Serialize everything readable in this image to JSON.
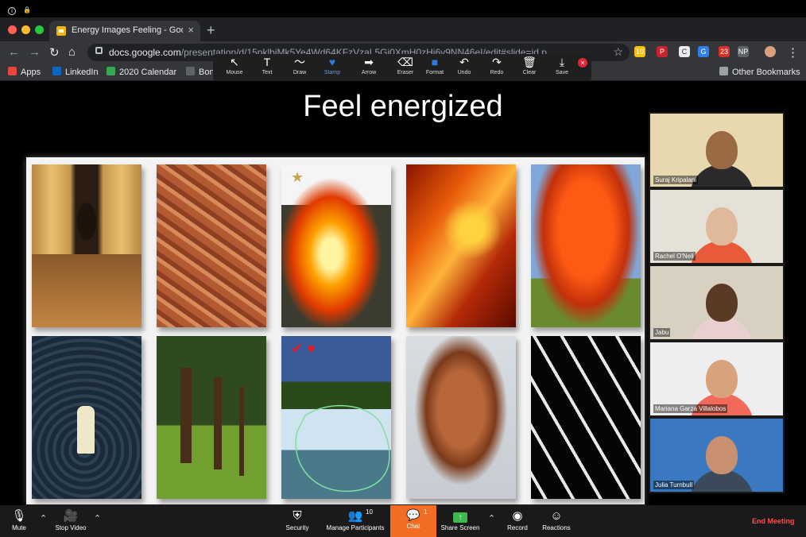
{
  "system": {
    "info_icon": "info-icon",
    "lock_icon": "lock-icon"
  },
  "browser": {
    "tab_title": "Energy Images Feeling - Google Slides",
    "new_tab": "+",
    "url_host": "docs.google.com",
    "url_path": "/presentation/d/15pklbiMk5Ye4Wd64KFzVzaL5Gi0XmH0zHi6v9NN46eI/edit#slide=id.p",
    "extensions": [
      {
        "name": "sticky-notes-ext",
        "label": "10",
        "color": "#f4c20d"
      },
      {
        "name": "pinterest-ext",
        "label": "P",
        "color": "#c8232c"
      },
      {
        "name": "copy-ext",
        "label": "C",
        "color": "#e8eaed"
      },
      {
        "name": "grammarly-ext",
        "label": "G",
        "color": "#2f80ed"
      },
      {
        "name": "photos-ext",
        "label": "23",
        "color": "#d93025"
      },
      {
        "name": "np-ext",
        "label": "NP",
        "color": "#5f6368"
      }
    ],
    "bookmarks": [
      {
        "label": "Apps",
        "icon": "apps-grid-icon",
        "color": "#e8453c"
      },
      {
        "label": "LinkedIn",
        "icon": "linkedin-icon",
        "color": "#0a66c2"
      },
      {
        "label": "2020 Calendar",
        "icon": "calendar-icon",
        "color": "#34a853"
      },
      {
        "label": "Bon",
        "icon": "bookmark-icon",
        "color": "#5f6368"
      }
    ],
    "other_bookmarks": "Other Bookmarks"
  },
  "annotation_toolbar": {
    "tools": [
      {
        "label": "Mouse",
        "icon": "mouse-pointer-icon",
        "glyph": "↖"
      },
      {
        "label": "Text",
        "icon": "text-icon",
        "glyph": "T"
      },
      {
        "label": "Draw",
        "icon": "draw-icon",
        "glyph": "〜"
      },
      {
        "label": "Stamp",
        "icon": "stamp-heart-icon",
        "glyph": "♥"
      },
      {
        "label": "Arrow",
        "icon": "arrow-icon",
        "glyph": "➡"
      },
      {
        "label": "Eraser",
        "icon": "eraser-icon",
        "glyph": "⌫"
      },
      {
        "label": "Format",
        "icon": "format-icon",
        "glyph": "■"
      },
      {
        "label": "Undo",
        "icon": "undo-icon",
        "glyph": "↶"
      },
      {
        "label": "Redo",
        "icon": "redo-icon",
        "glyph": "↷"
      },
      {
        "label": "Clear",
        "icon": "trash-icon",
        "glyph": "🗑"
      },
      {
        "label": "Save",
        "icon": "save-icon",
        "glyph": "⤓"
      }
    ],
    "active_tool": "Stamp",
    "close_glyph": "×"
  },
  "slide": {
    "title": "Feel energized",
    "photos": [
      {
        "name": "photo-golden-hallway",
        "mark": ""
      },
      {
        "name": "photo-terracotta-roofs",
        "mark": ""
      },
      {
        "name": "photo-bonfire",
        "mark": "★",
        "mark_color": "#c9a64a"
      },
      {
        "name": "photo-carousel-horse",
        "mark": ""
      },
      {
        "name": "photo-autumn-tree",
        "mark": ""
      },
      {
        "name": "photo-person-in-water",
        "mark": ""
      },
      {
        "name": "photo-pine-trees",
        "mark": ""
      },
      {
        "name": "photo-river-rapids",
        "mark": "✔ ♥",
        "mark_color": "#e51d2a"
      },
      {
        "name": "photo-statue-face",
        "mark": ""
      },
      {
        "name": "photo-chains",
        "mark": ""
      }
    ]
  },
  "participants": [
    {
      "name": "Suraj Kripalani",
      "bg": "#e8d8b0",
      "skin": "#9a6a44",
      "shirt": "#2b2b2b"
    },
    {
      "name": "Rachel O'Neil",
      "bg": "#e6e1d6",
      "skin": "#e0b89c",
      "shirt": "#e85a3a"
    },
    {
      "name": "Jabu",
      "bg": "#d8d0c0",
      "skin": "#5a3a24",
      "shirt": "#e8d0d0"
    },
    {
      "name": "Mariana Garza Villalobos",
      "bg": "#eeeeee",
      "skin": "#d8a27c",
      "shirt": "#f06a5a"
    },
    {
      "name": "Julia Turnbull",
      "bg": "#3a78c0",
      "skin": "#c89070",
      "shirt": "#3a4a5a"
    }
  ],
  "zoom_controls": {
    "mute": "Mute",
    "stop_video": "Stop Video",
    "security": "Security",
    "manage_participants": "Manage Participants",
    "participant_count": "10",
    "chat": "Chat",
    "chat_count": "1",
    "share_screen": "Share Screen",
    "record": "Record",
    "reactions": "Reactions",
    "end_meeting": "End Meeting"
  }
}
